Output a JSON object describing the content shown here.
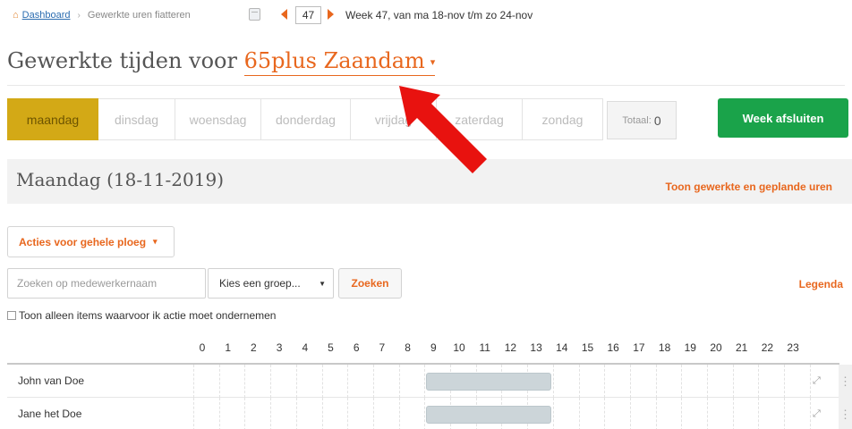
{
  "breadcrumb": {
    "home_label": "Dashboard",
    "separator": "›",
    "current": "Gewerkte uren fiatteren"
  },
  "week_nav": {
    "week_number": "47",
    "label": "Week 47, van ma 18-nov t/m zo 24-nov"
  },
  "title": {
    "prefix": "Gewerkte tijden voor",
    "location": "65plus Zaandam",
    "caret": "▾"
  },
  "days": [
    {
      "label": "maandag",
      "active": true
    },
    {
      "label": "dinsdag",
      "active": false
    },
    {
      "label": "woensdag",
      "active": false
    },
    {
      "label": "donderdag",
      "active": false
    },
    {
      "label": "vrijdag",
      "active": false
    },
    {
      "label": "zaterdag",
      "active": false
    },
    {
      "label": "zondag",
      "active": false
    }
  ],
  "total": {
    "label": "Totaal:",
    "value": "0"
  },
  "close_week_label": "Week afsluiten",
  "day_header": {
    "title": "Maandag (18-11-2019)",
    "toggle_link": "Toon gewerkte en geplande uren"
  },
  "actions": {
    "label": "Acties voor gehele ploeg",
    "caret": "▾"
  },
  "search": {
    "placeholder": "Zoeken op medewerkernaam",
    "group_select": "Kies een groep...",
    "group_caret": "▼",
    "button": "Zoeken"
  },
  "legend_label": "Legenda",
  "filter_label": "Toon alleen items waarvoor ik actie moet ondernemen",
  "hours": [
    "0",
    "1",
    "2",
    "3",
    "4",
    "5",
    "6",
    "7",
    "8",
    "9",
    "10",
    "11",
    "12",
    "13",
    "14",
    "15",
    "16",
    "17",
    "18",
    "19",
    "20",
    "21",
    "22",
    "23"
  ],
  "employees": [
    {
      "name": "John van Doe",
      "shift_start": 9,
      "shift_end": 14
    },
    {
      "name": "Jane het Doe",
      "shift_start": 9,
      "shift_end": 14
    }
  ],
  "icons": {
    "home": "home-icon",
    "calendar": "calendar-icon",
    "expand": "expand-icon",
    "drag": "drag-handle-icon"
  },
  "colors": {
    "accent": "#e8671e",
    "active_day": "#d3a916",
    "close_week": "#1aa34a",
    "shift_bar": "#ccd5d9",
    "annotation_arrow": "#e8120f"
  }
}
